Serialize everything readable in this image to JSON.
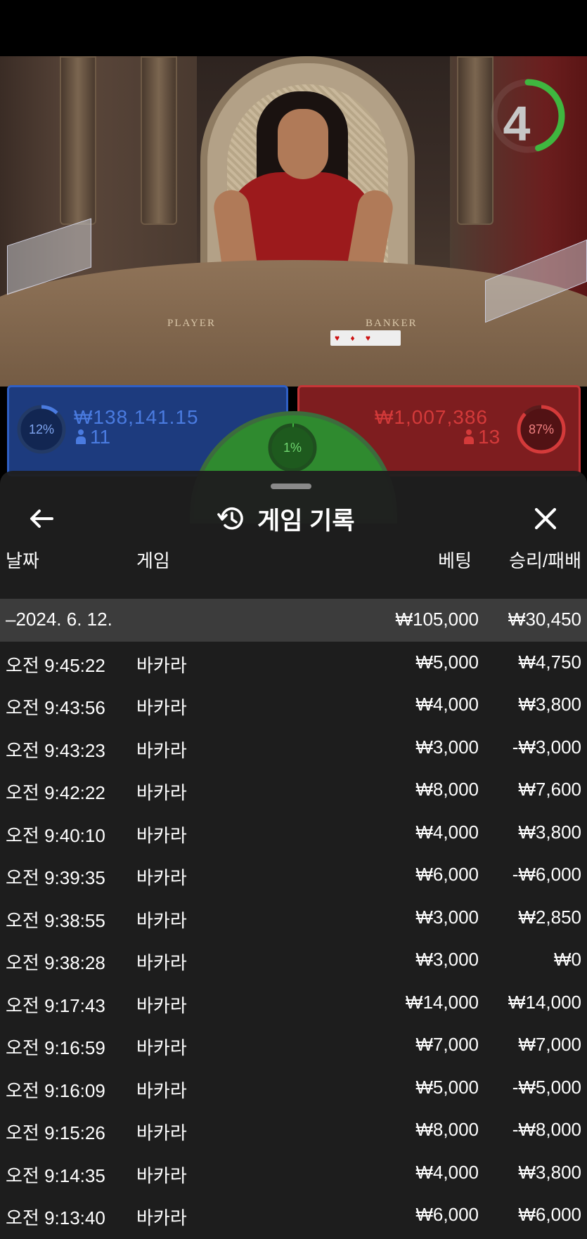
{
  "colors": {
    "player_blue": "#4a7be0",
    "banker_red": "#d43a3a",
    "tie_green": "#3fb73f",
    "sheet_bg": "#1e1e1e",
    "date_row_bg": "#3c3c3c"
  },
  "video": {
    "table_player_label": "PLAYER",
    "table_banker_label": "BANKER",
    "timer_value": "4",
    "timer_fraction": 0.45,
    "card_suits": "♥ ♦ ♥"
  },
  "bets": {
    "player": {
      "percent_label": "12%",
      "percent": 0.12,
      "amount": "₩138,141.15",
      "players": "11"
    },
    "tie": {
      "percent_label": "1%",
      "percent": 0.01
    },
    "banker": {
      "percent_label": "87%",
      "percent": 0.87,
      "amount": "₩1,007,386",
      "players": "13"
    }
  },
  "history": {
    "title": "게임 기록",
    "icons": {
      "back": "arrow-left-icon",
      "history": "history-clock-icon",
      "close": "close-x-icon"
    },
    "columns": {
      "date": "날짜",
      "game": "게임",
      "bet": "베팅",
      "result": "승리/패배"
    },
    "date_group": {
      "label": "–2024. 6. 12.",
      "bet": "₩105,000",
      "result": "₩30,450"
    },
    "rows": [
      {
        "time": "오전 9:45:22",
        "game": "바카라",
        "bet": "₩5,000",
        "result": "₩4,750"
      },
      {
        "time": "오전 9:43:56",
        "game": "바카라",
        "bet": "₩4,000",
        "result": "₩3,800"
      },
      {
        "time": "오전 9:43:23",
        "game": "바카라",
        "bet": "₩3,000",
        "result": "-₩3,000"
      },
      {
        "time": "오전 9:42:22",
        "game": "바카라",
        "bet": "₩8,000",
        "result": "₩7,600"
      },
      {
        "time": "오전 9:40:10",
        "game": "바카라",
        "bet": "₩4,000",
        "result": "₩3,800"
      },
      {
        "time": "오전 9:39:35",
        "game": "바카라",
        "bet": "₩6,000",
        "result": "-₩6,000"
      },
      {
        "time": "오전 9:38:55",
        "game": "바카라",
        "bet": "₩3,000",
        "result": "₩2,850"
      },
      {
        "time": "오전 9:38:28",
        "game": "바카라",
        "bet": "₩3,000",
        "result": "₩0"
      },
      {
        "time": "오전 9:17:43",
        "game": "바카라",
        "bet": "₩14,000",
        "result": "₩14,000"
      },
      {
        "time": "오전 9:16:59",
        "game": "바카라",
        "bet": "₩7,000",
        "result": "₩7,000"
      },
      {
        "time": "오전 9:16:09",
        "game": "바카라",
        "bet": "₩5,000",
        "result": "-₩5,000"
      },
      {
        "time": "오전 9:15:26",
        "game": "바카라",
        "bet": "₩8,000",
        "result": "-₩8,000"
      },
      {
        "time": "오전 9:14:35",
        "game": "바카라",
        "bet": "₩4,000",
        "result": "₩3,800"
      },
      {
        "time": "오전 9:13:40",
        "game": "바카라",
        "bet": "₩6,000",
        "result": "₩6,000"
      }
    ]
  }
}
